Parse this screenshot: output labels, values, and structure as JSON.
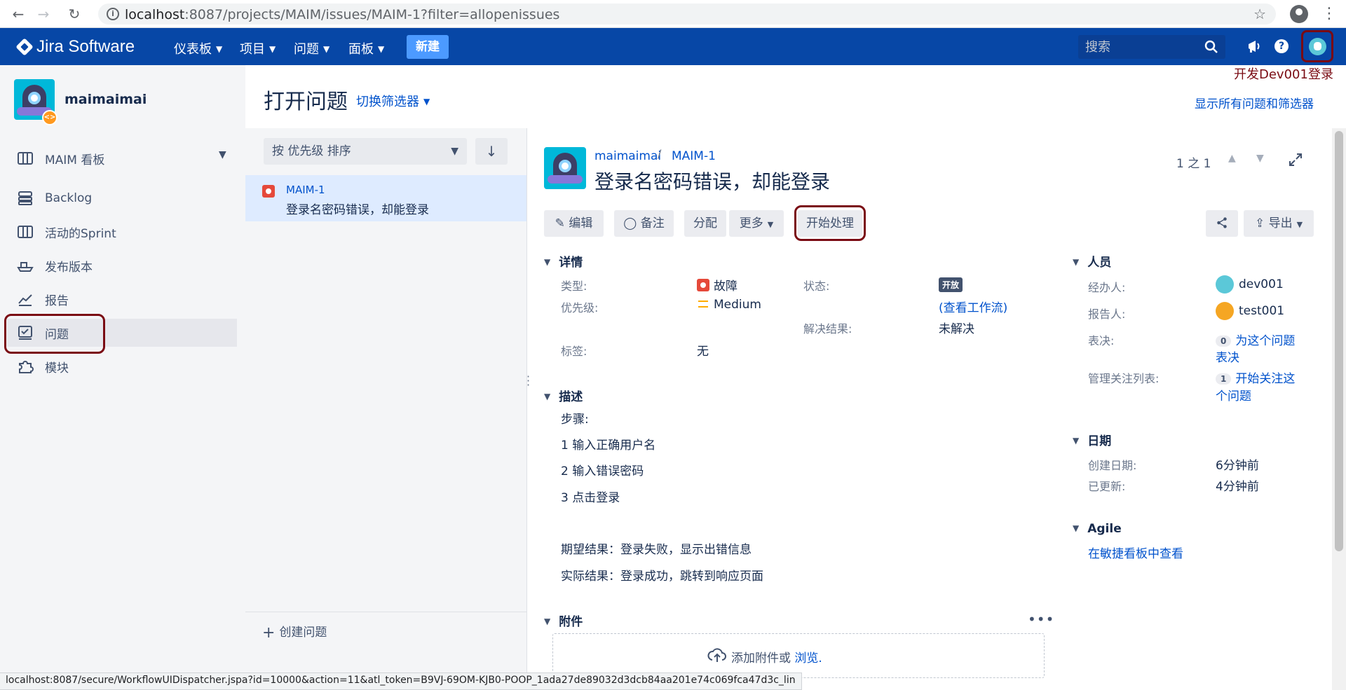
{
  "browser": {
    "url_host": "localhost",
    "url_path": ":8087/projects/MAIM/issues/MAIM-1?filter=allopenissues"
  },
  "topbar": {
    "product": "Jira Software",
    "menus": [
      "仪表板",
      "项目",
      "问题",
      "面板"
    ],
    "create": "新建",
    "search_placeholder": "搜索"
  },
  "annotation": "开发Dev001登录",
  "sidebar": {
    "project_name": "maimaimai",
    "items": [
      {
        "label": "MAIM 看板",
        "icon": "board-icon"
      },
      {
        "label": "Backlog",
        "icon": "backlog-icon"
      },
      {
        "label": "活动的Sprint",
        "icon": "sprint-icon"
      },
      {
        "label": "发布版本",
        "icon": "ship-icon"
      },
      {
        "label": "报告",
        "icon": "chart-icon"
      },
      {
        "label": "问题",
        "icon": "issues-icon"
      },
      {
        "label": "模块",
        "icon": "puzzle-icon"
      }
    ]
  },
  "header": {
    "title": "打开问题",
    "switch_filter": "切换筛选器",
    "show_all": "显示所有问题和筛选器"
  },
  "list": {
    "sort_label": "按 优先级 排序",
    "items": [
      {
        "key": "MAIM-1",
        "summary": "登录名密码错误，却能登录"
      }
    ],
    "create_issue": "创建问题"
  },
  "issue": {
    "project": "maimaimai",
    "key": "MAIM-1",
    "title": "登录名密码错误，却能登录",
    "pager": "1 之 1",
    "toolbar": {
      "edit": "编辑",
      "comment": "备注",
      "assign": "分配",
      "more": "更多",
      "start_progress": "开始处理",
      "export": "导出"
    },
    "details": {
      "heading": "详情",
      "type_label": "类型:",
      "type_value": "故障",
      "priority_label": "优先级:",
      "priority_value": "Medium",
      "labels_label": "标签:",
      "labels_value": "无",
      "status_label": "状态:",
      "status_value": "开放",
      "workflow_link": "(查看工作流)",
      "resolution_label": "解决结果:",
      "resolution_value": "未解决"
    },
    "description": {
      "heading": "描述",
      "lines": [
        "步骤:",
        "1 输入正确用户名",
        "2 输入错误密码",
        "3 点击登录",
        "期望结果：登录失败，显示出错信息",
        "实际结果：登录成功，跳转到响应页面"
      ]
    },
    "attachments": {
      "heading": "附件",
      "drop_text": "添加附件或",
      "browse": "浏览."
    },
    "people": {
      "heading": "人员",
      "assignee_label": "经办人:",
      "assignee": "dev001",
      "reporter_label": "报告人:",
      "reporter": "test001",
      "votes_label": "表决:",
      "votes_count": "0",
      "votes_link_1": "为这个问题",
      "votes_link_2": "表决",
      "watchers_label": "管理关注列表:",
      "watchers_count": "1",
      "watch_link_1": "开始关注这",
      "watch_link_2": "个问题"
    },
    "dates": {
      "heading": "日期",
      "created_label": "创建日期:",
      "created": "6分钟前",
      "updated_label": "已更新:",
      "updated": "4分钟前"
    },
    "agile": {
      "heading": "Agile",
      "link": "在敏捷看板中查看"
    }
  },
  "status_bar_url": "localhost:8087/secure/WorkflowUIDispatcher.jspa?id=10000&action=11&atl_token=B9VJ-69OM-KJB0-POOP_1ada27de89032d3dcb84aa201e74c069fca47d3c_lin"
}
